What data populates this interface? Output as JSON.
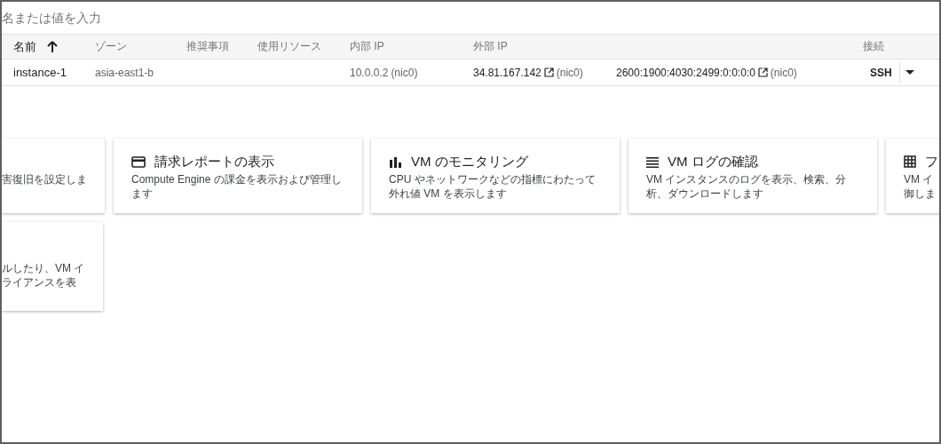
{
  "search": {
    "placeholder": "名または値を入力"
  },
  "table": {
    "columns": [
      {
        "label": "名前",
        "sorted": true
      },
      {
        "label": "ゾーン",
        "sorted": false
      },
      {
        "label": "推奨事項",
        "sorted": false
      },
      {
        "label": "使用リソース",
        "sorted": false
      },
      {
        "label": "内部 IP",
        "sorted": false
      },
      {
        "label": "外部 IP",
        "sorted": false
      },
      {
        "label": "接続",
        "sorted": false
      }
    ],
    "rows": [
      {
        "name": "instance-1",
        "zone": "asia-east1-b",
        "internal_ip": "10.0.0.2",
        "internal_nic": "(nic0)",
        "external_ip": "34.81.167.142",
        "external_nic": "(nic0)",
        "ipv6": "2600:1900:4030:2499:0:0:0:0",
        "ipv6_nic": "(nic0)",
        "connect": "SSH"
      }
    ]
  },
  "cards": [
    {
      "kind": "cut-left",
      "lines": [
        "害復旧を設定しま"
      ]
    },
    {
      "kind": "full",
      "title": "請求レポートの表示",
      "lines": [
        "Compute Engine の課金を表示および管理し",
        "ます"
      ]
    },
    {
      "kind": "full",
      "title": "VM のモニタリング",
      "lines": [
        "CPU やネットワークなどの指標にわたって",
        "外れ値 VM を表示します"
      ]
    },
    {
      "kind": "full",
      "title": "VM ログの確認",
      "lines": [
        "VM インスタンスのログを表示、検索、分",
        "析、ダウンロードします"
      ]
    },
    {
      "kind": "cut-right",
      "title": "フ",
      "lines": [
        "VM イ",
        "御しま"
      ]
    }
  ],
  "cards_row_2": [
    {
      "kind": "cut-left",
      "lines": [
        "ルしたり、VM イ",
        "ライアンスを表"
      ]
    }
  ]
}
